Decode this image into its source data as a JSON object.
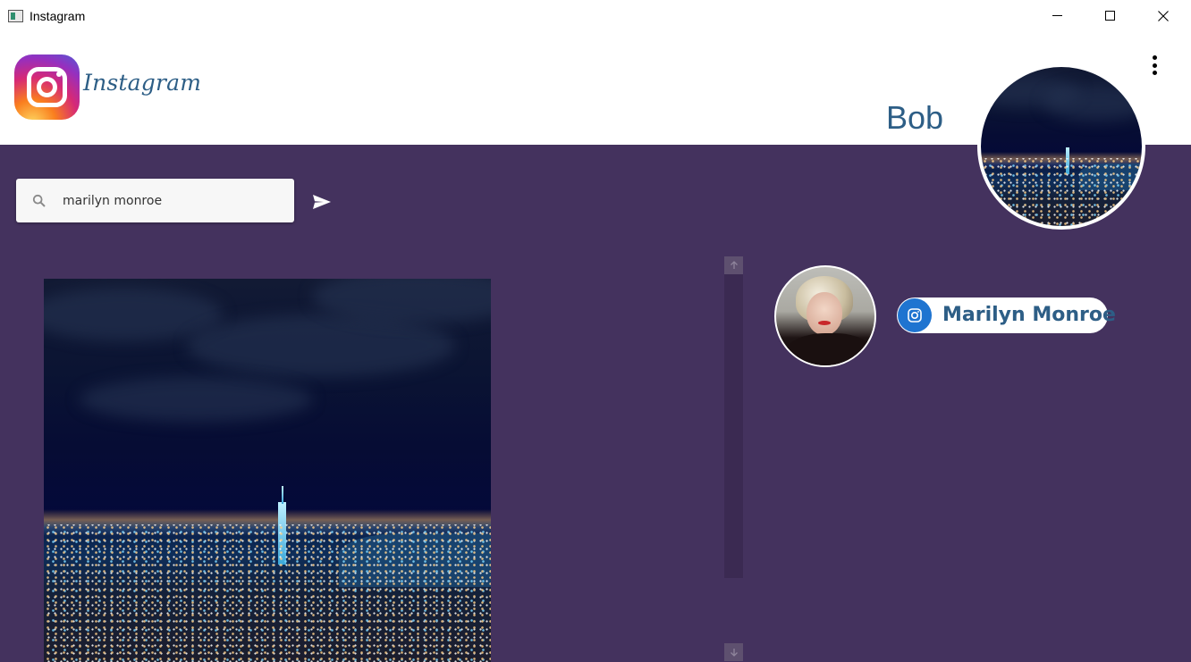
{
  "window": {
    "title": "Instagram",
    "controls": [
      "minimize-icon",
      "maximize-icon",
      "close-icon"
    ]
  },
  "header": {
    "brand": "Instagram",
    "username": "Bob",
    "menu_icon": "more-vert-icon"
  },
  "search": {
    "value": "marilyn monroe",
    "icon": "search-icon",
    "send_icon": "send-icon"
  },
  "result": {
    "name": "Marilyn Monroe",
    "badge_icon": "instagram-icon"
  },
  "scrollbar": {
    "up_icon": "arrow-up-icon",
    "down_icon": "arrow-down-icon"
  },
  "colors": {
    "background": "#44325e",
    "accent": "#2d5e86",
    "badge": "#1f74d0"
  }
}
